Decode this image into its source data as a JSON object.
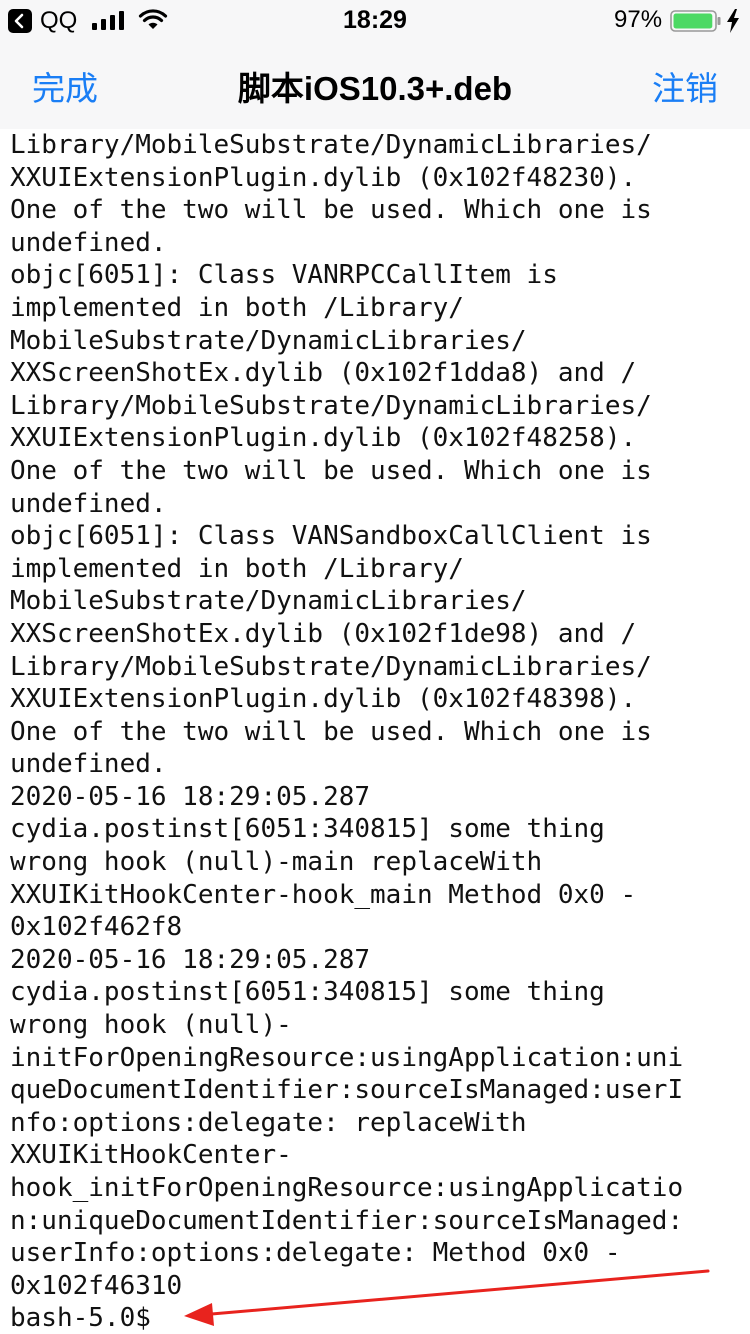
{
  "status_bar": {
    "back_app": "QQ",
    "time": "18:29",
    "battery_percent": "97%",
    "battery_level": 0.97,
    "charging": true
  },
  "nav": {
    "left_button": "完成",
    "title": "脚本iOS10.3+.deb",
    "right_button": "注销"
  },
  "terminal": {
    "lines": [
      "Library/MobileSubstrate/DynamicLibraries/",
      "XXUIExtensionPlugin.dylib (0x102f48230).",
      "One of the two will be used. Which one is",
      "undefined.",
      "objc[6051]: Class VANRPCCallItem is",
      "implemented in both /Library/",
      "MobileSubstrate/DynamicLibraries/",
      "XXScreenShotEx.dylib (0x102f1dda8) and /",
      "Library/MobileSubstrate/DynamicLibraries/",
      "XXUIExtensionPlugin.dylib (0x102f48258).",
      "One of the two will be used. Which one is",
      "undefined.",
      "objc[6051]: Class VANSandboxCallClient is",
      "implemented in both /Library/",
      "MobileSubstrate/DynamicLibraries/",
      "XXScreenShotEx.dylib (0x102f1de98) and /",
      "Library/MobileSubstrate/DynamicLibraries/",
      "XXUIExtensionPlugin.dylib (0x102f48398).",
      "One of the two will be used. Which one is",
      "undefined.",
      "2020-05-16 18:29:05.287",
      "cydia.postinst[6051:340815] some thing",
      "wrong hook (null)-main replaceWith",
      "XXUIKitHookCenter-hook_main Method 0x0 -",
      "0x102f462f8",
      "2020-05-16 18:29:05.287",
      "cydia.postinst[6051:340815] some thing",
      "wrong hook (null)-",
      "initForOpeningResource:usingApplication:uni",
      "queDocumentIdentifier:sourceIsManaged:userI",
      "nfo:options:delegate: replaceWith",
      "XXUIKitHookCenter-",
      "hook_initForOpeningResource:usingApplicatio",
      "n:uniqueDocumentIdentifier:sourceIsManaged:",
      "userInfo:options:delegate: Method 0x0 -",
      "0x102f46310",
      "bash-5.0$"
    ]
  },
  "colors": {
    "accent": "#1a7ef5",
    "annotation_arrow": "#e8231e",
    "battery_fill": "#4cd964"
  }
}
